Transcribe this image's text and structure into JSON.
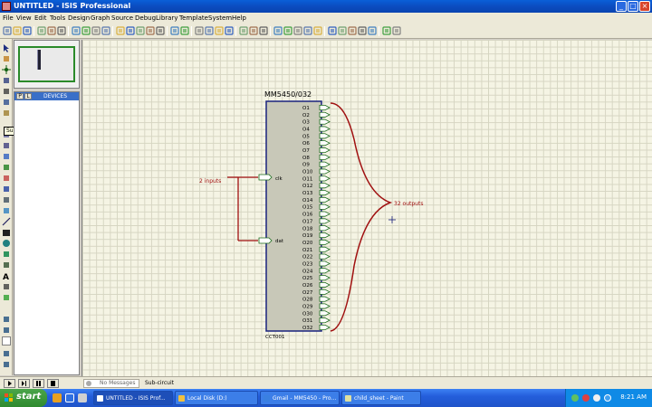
{
  "window": {
    "title": "UNTITLED - ISIS Professional",
    "buttons": [
      "_",
      "□",
      "×"
    ]
  },
  "menu": [
    "File",
    "View",
    "Edit",
    "Tools",
    "Design",
    "Graph",
    "Source",
    "Debug",
    "Library",
    "Template",
    "System",
    "Help"
  ],
  "toolbar_icons": [
    "new-icon",
    "open-icon",
    "save-icon",
    "import-icon",
    "export-icon",
    "print-icon",
    "area-icon",
    "refresh-icon",
    "grid-icon",
    "origin-icon",
    "pan-icon",
    "zoom-in-icon",
    "zoom-out-icon",
    "zoom-all-icon",
    "zoom-area-icon",
    "undo-icon",
    "redo-icon",
    "cut-icon",
    "copy-icon",
    "paste-icon",
    "block-copy-icon",
    "block-move-icon",
    "block-rotate-icon",
    "block-delete-icon",
    "pick-device-icon",
    "make-device-icon",
    "packaging-icon",
    "decompose-icon",
    "wire-autoroute-icon",
    "search-icon",
    "property-icon",
    "sheet-icon",
    "netlist-icon",
    "bom-icon",
    "erc-icon",
    "ares-icon"
  ],
  "sidebar": {
    "tooltip": "Subcircuit Mode",
    "device_tabs": [
      "P",
      "L"
    ],
    "devices_label": "DEVICES"
  },
  "schematic": {
    "part_name": "MM5450/032",
    "part_ref": "CCT001",
    "left_pins": [
      "clk",
      "dat"
    ],
    "output_pins": [
      "O1",
      "O2",
      "O3",
      "O4",
      "O5",
      "O6",
      "O7",
      "O8",
      "O9",
      "O10",
      "O11",
      "O12",
      "O13",
      "O14",
      "O15",
      "O16",
      "O17",
      "O18",
      "O19",
      "O20",
      "O21",
      "O22",
      "O23",
      "O24",
      "O25",
      "O26",
      "O27",
      "O28",
      "O29",
      "O30",
      "O31",
      "O32"
    ],
    "inputs_label": "2 inputs",
    "outputs_label": "32 outputs"
  },
  "status": {
    "messages": "No Messages",
    "mode": "Sub-circuit"
  },
  "taskbar": {
    "start": "start",
    "tasks": [
      "UNTITLED - ISIS Prof...",
      "Local Disk (D:)",
      "Gmail - MM5450 - Pro...",
      "child_sheet - Paint"
    ],
    "clock": "8:21 AM"
  },
  "colors": {
    "wire": "#a01010",
    "pin": "#1a6a1a",
    "body_fill": "#c8c8b8",
    "body_border": "#1a237e"
  }
}
